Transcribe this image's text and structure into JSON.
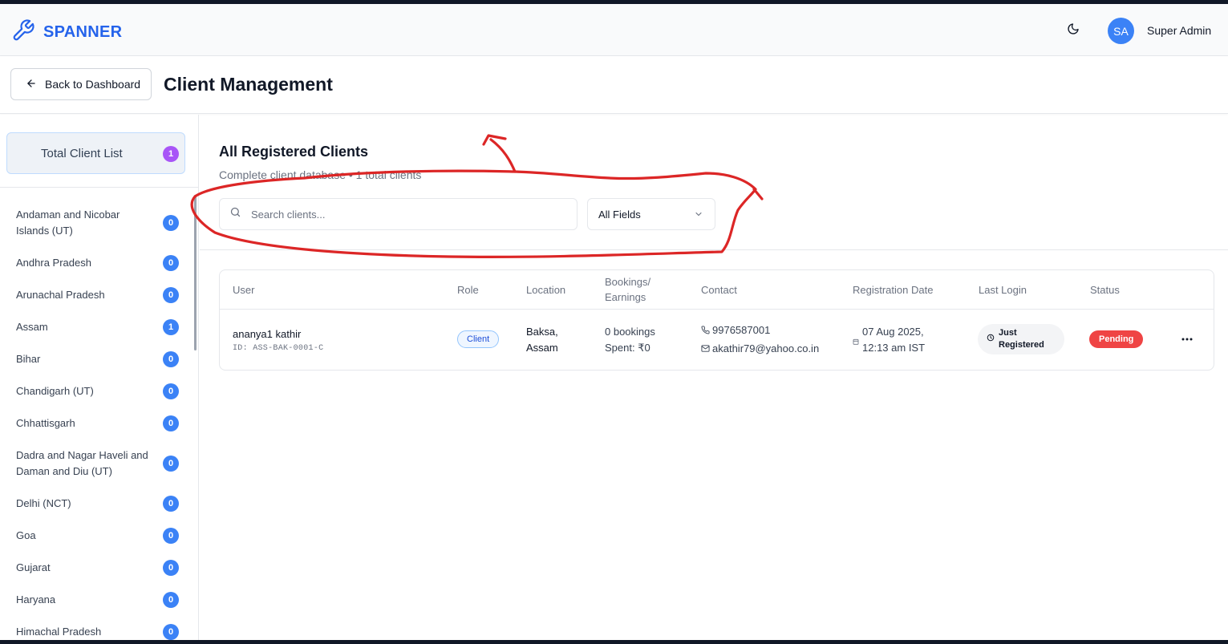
{
  "app": {
    "brand": "SPANNER",
    "brand_color": "#2563eb",
    "user": {
      "initials": "SA",
      "name": "Super Admin"
    }
  },
  "header": {
    "back_label": "Back to Dashboard",
    "title": "Client Management"
  },
  "sidebar": {
    "total": {
      "label": "Total Client List",
      "count": "1",
      "badge_color": "#a855f7"
    },
    "states": [
      {
        "name": "Andaman and Nicobar Islands (UT)",
        "count": "0"
      },
      {
        "name": "Andhra Pradesh",
        "count": "0"
      },
      {
        "name": "Arunachal Pradesh",
        "count": "0"
      },
      {
        "name": "Assam",
        "count": "1"
      },
      {
        "name": "Bihar",
        "count": "0"
      },
      {
        "name": "Chandigarh (UT)",
        "count": "0"
      },
      {
        "name": "Chhattisgarh",
        "count": "0"
      },
      {
        "name": "Dadra and Nagar Haveli and Daman and Diu (UT)",
        "count": "0"
      },
      {
        "name": "Delhi (NCT)",
        "count": "0"
      },
      {
        "name": "Goa",
        "count": "0"
      },
      {
        "name": "Gujarat",
        "count": "0"
      },
      {
        "name": "Haryana",
        "count": "0"
      },
      {
        "name": "Himachal Pradesh",
        "count": "0"
      }
    ]
  },
  "main": {
    "section_title": "All Registered Clients",
    "section_subtitle": "Complete client database • 1 total clients",
    "search": {
      "placeholder": "Search clients...",
      "value": ""
    },
    "field_filter": {
      "selected": "All Fields"
    },
    "table": {
      "headers": {
        "user": "User",
        "role": "Role",
        "location": "Location",
        "bookings_line1": "Bookings/",
        "bookings_line2": "Earnings",
        "contact": "Contact",
        "registration": "Registration Date",
        "last_login": "Last Login",
        "status": "Status"
      },
      "rows": [
        {
          "name": "ananya1 kathir",
          "id": "ID: ASS-BAK-0001-C",
          "role": "Client",
          "location_line1": "Baksa,",
          "location_line2": "Assam",
          "bookings": "0 bookings",
          "spent": "Spent: ₹0",
          "phone": "9976587001",
          "email": "akathir79@yahoo.co.in",
          "reg_date": "07 Aug 2025,",
          "reg_time": "12:13 am IST",
          "last_login_line1": "Just",
          "last_login_line2": "Registered",
          "status": "Pending",
          "status_color": "#ef4444"
        }
      ]
    }
  },
  "icons": [
    "wrench-icon",
    "moon-icon",
    "arrow-left-icon",
    "search-icon",
    "chevron-down-icon",
    "phone-icon",
    "mail-icon",
    "calendar-icon",
    "clock-icon",
    "more-horizontal-icon"
  ],
  "annotation_color": "#dc2626"
}
